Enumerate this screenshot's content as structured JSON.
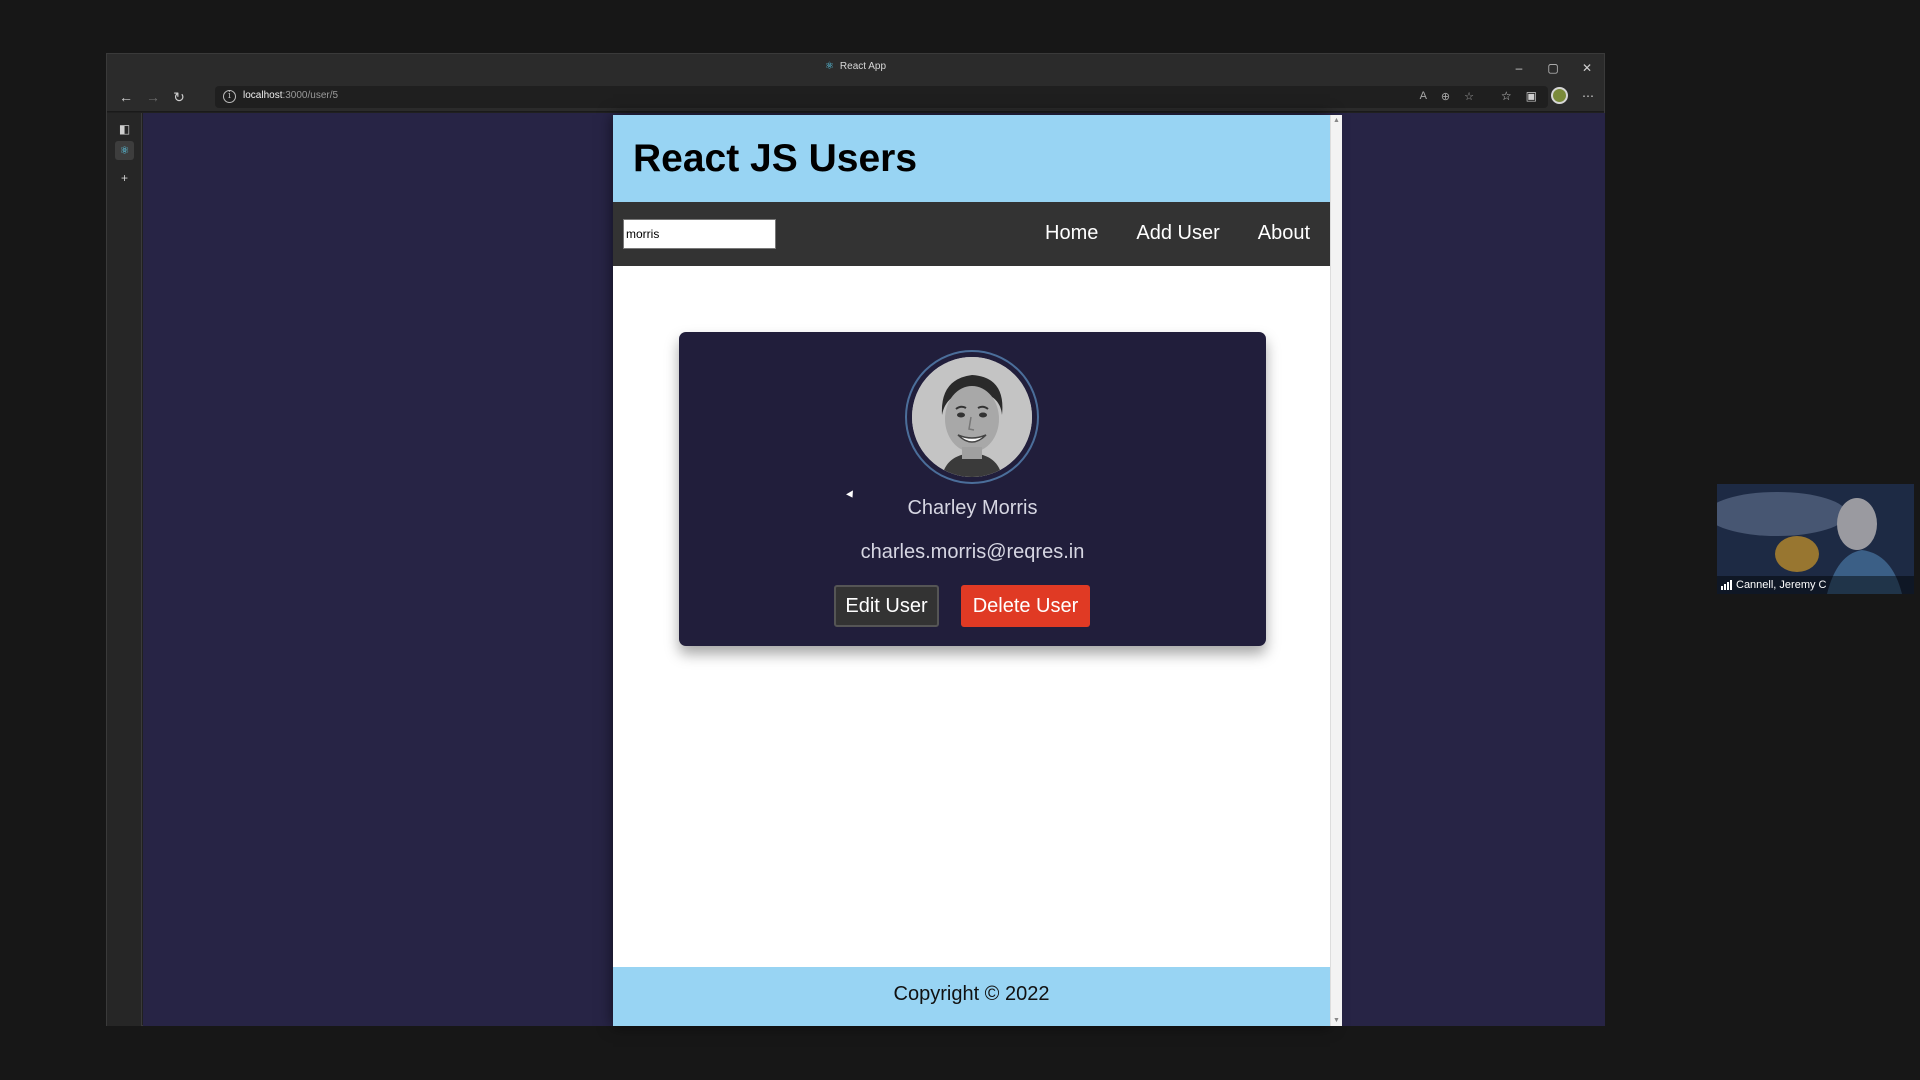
{
  "browser": {
    "title": "React App",
    "url_host": "localhost",
    "url_path": ":3000/user/5"
  },
  "app": {
    "header_title": "React JS Users",
    "search_value": "morris",
    "nav": [
      {
        "label": "Home"
      },
      {
        "label": "Add User"
      },
      {
        "label": "About"
      }
    ],
    "user": {
      "name": "Charley Morris",
      "email": "charles.morris@reqres.in",
      "edit_label": "Edit User",
      "delete_label": "Delete User"
    },
    "footer_text": "Copyright © 2022"
  },
  "meeting": {
    "participant_name": "Cannell, Jeremy C"
  },
  "colors": {
    "header_bg": "#98d4f3",
    "navbar_bg": "#333333",
    "card_bg": "#211e3b",
    "delete_button": "#e03a24",
    "viewport_bg": "#272445"
  }
}
